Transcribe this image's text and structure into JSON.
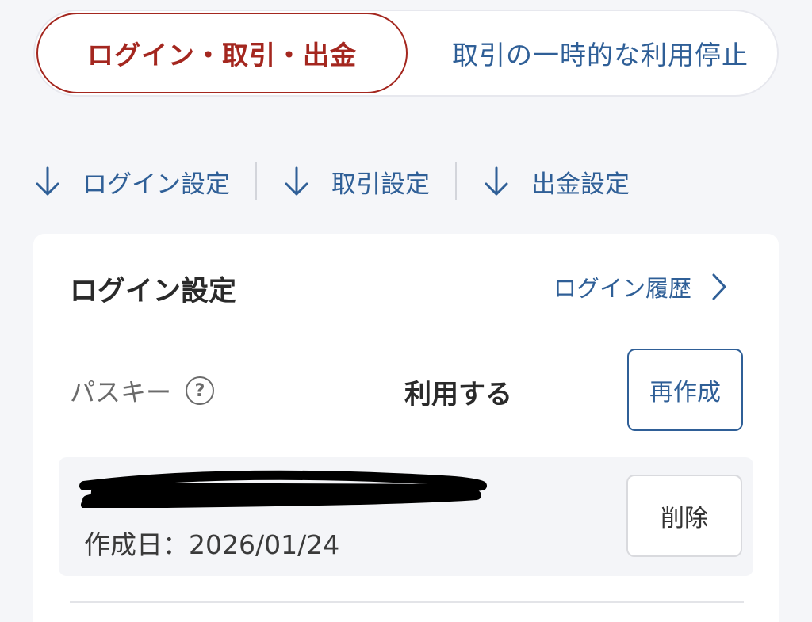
{
  "tabs": [
    {
      "label": "ログイン・取引・出金",
      "active": true
    },
    {
      "label": "取引の一時的な利用停止",
      "active": false
    }
  ],
  "jump_links": [
    {
      "label": "ログイン設定",
      "icon": "arrow-down-icon"
    },
    {
      "label": "取引設定",
      "icon": "arrow-down-icon"
    },
    {
      "label": "出金設定",
      "icon": "arrow-down-icon"
    }
  ],
  "login_settings": {
    "title": "ログイン設定",
    "history_link": "ログイン履歴",
    "passkey": {
      "label": "パスキー",
      "help_icon": "?",
      "status": "利用する",
      "recreate_button": "再作成"
    },
    "registered_key": {
      "created_label": "作成日：2026/01/24",
      "delete_button": "削除"
    }
  },
  "colors": {
    "accent_red": "#a4271f",
    "link_blue": "#2f5f97",
    "background": "#f5f6f9"
  }
}
